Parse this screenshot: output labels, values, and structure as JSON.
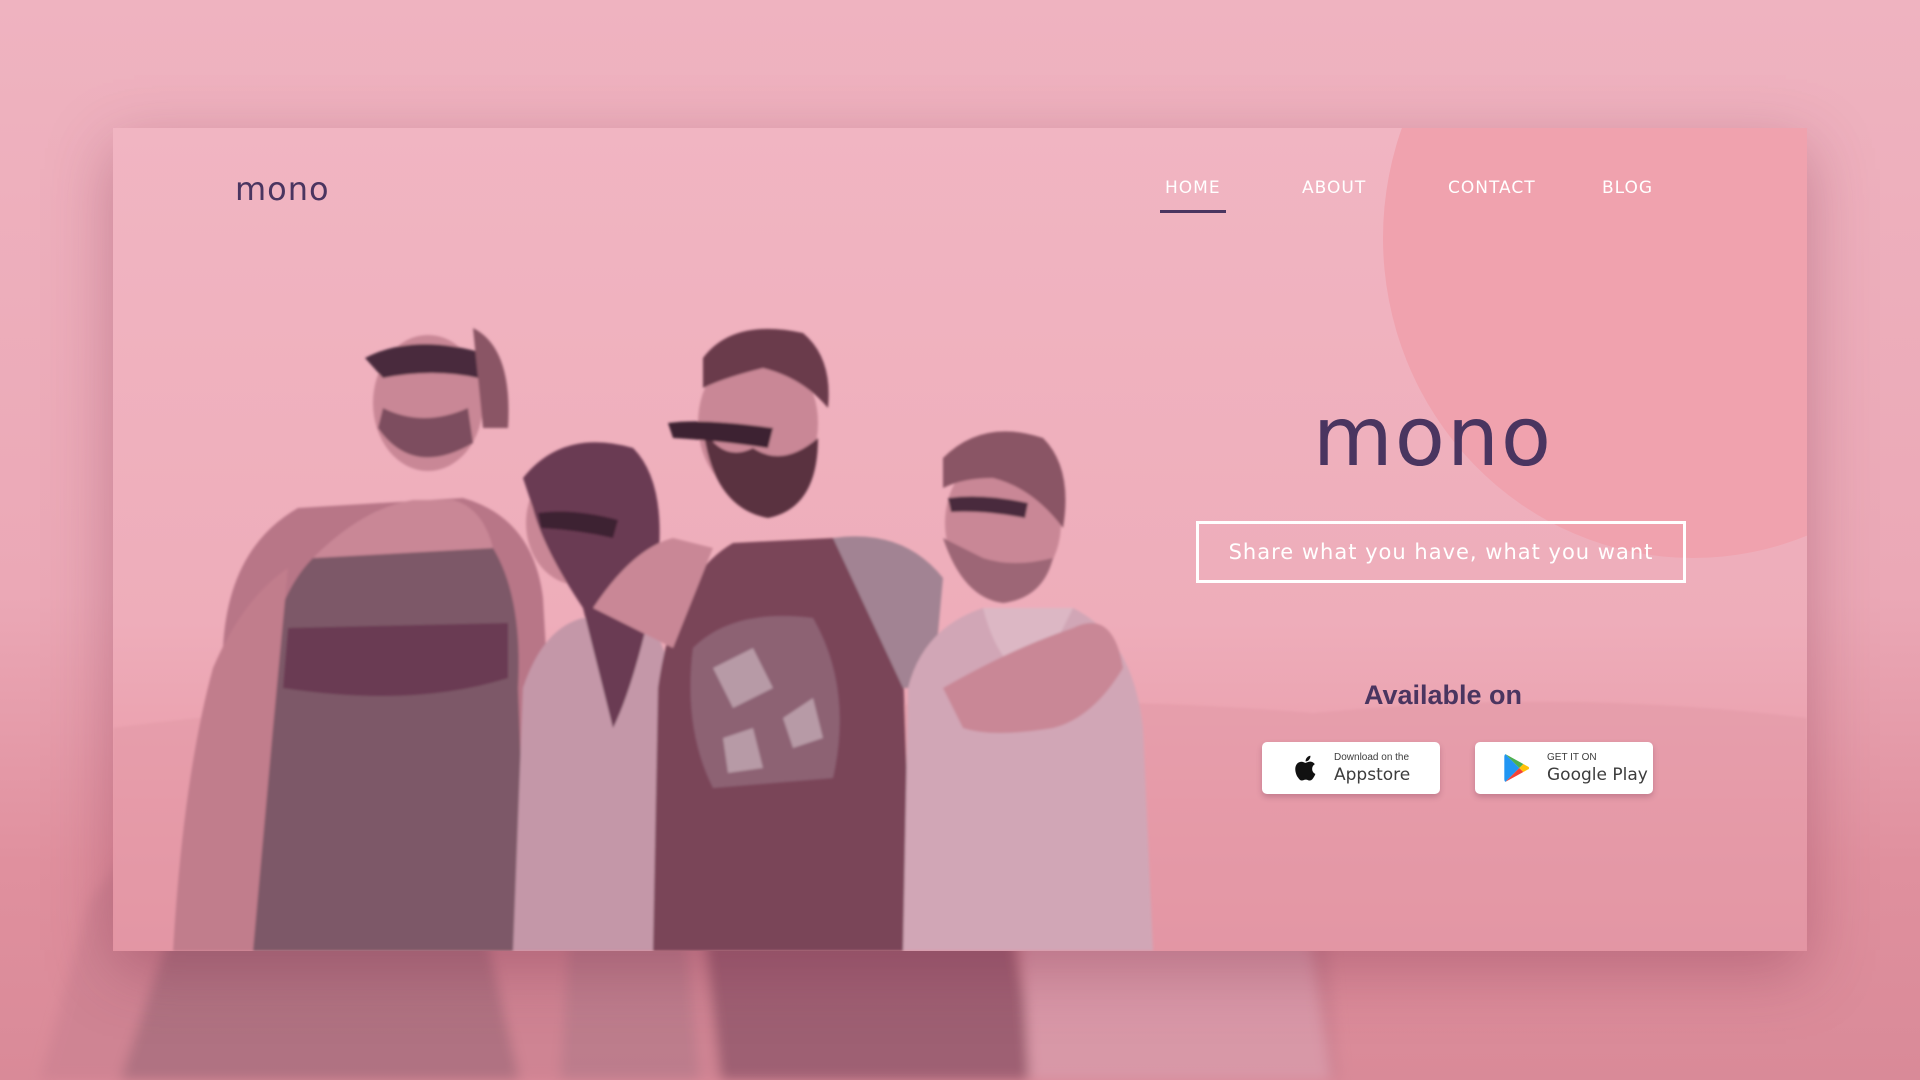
{
  "page": {
    "background_color": "#efb3c0",
    "accent_color": "#4a3560",
    "circle_color": "#f0a2ae"
  },
  "header": {
    "logo": "mono",
    "nav": [
      {
        "label": "HOME",
        "active": true
      },
      {
        "label": "ABOUT",
        "active": false
      },
      {
        "label": "CONTACT",
        "active": false
      },
      {
        "label": "BLOG",
        "active": false
      }
    ]
  },
  "hero": {
    "title": "mono",
    "tagline": "Share what you have, what you want",
    "available_label": "Available on",
    "stores": [
      {
        "icon": "apple-icon",
        "small": "Download on the",
        "big": "Appstore"
      },
      {
        "icon": "google-play-icon",
        "small": "GET IT ON",
        "big": "Google Play"
      }
    ],
    "photo": "four-friends-laughing-photo"
  }
}
